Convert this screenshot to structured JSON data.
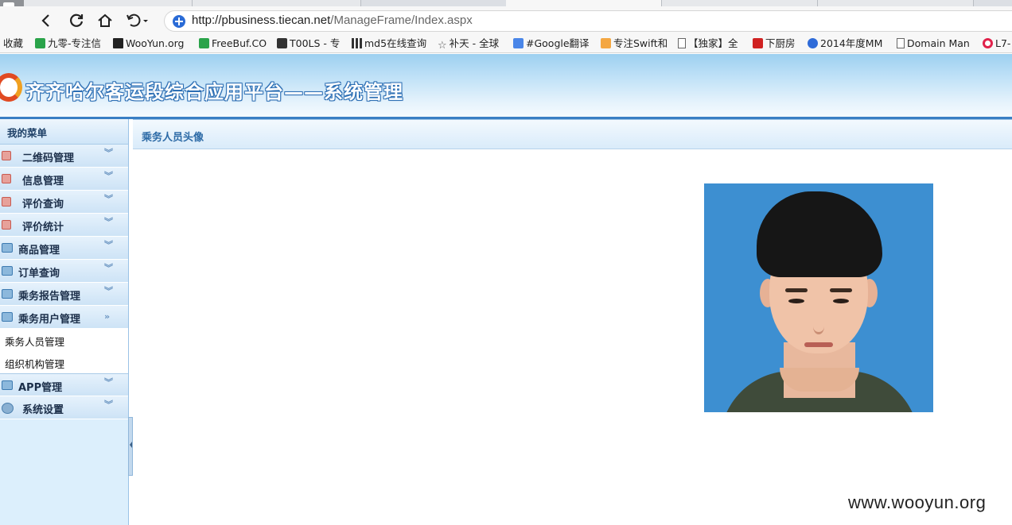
{
  "browser": {
    "url_host": "http://pbusiness.tiecan.net",
    "url_path": "/ManageFrame/Index.aspx",
    "bookmarks": [
      {
        "label": "收藏",
        "icon": "none"
      },
      {
        "label": "九零-专注信",
        "icon": "leaf-icon"
      },
      {
        "label": "WooYun.org",
        "icon": "wooyun-icon"
      },
      {
        "label": "FreeBuf.CO",
        "icon": "freebuf-icon"
      },
      {
        "label": "T00LS - 专",
        "icon": "tools-icon"
      },
      {
        "label": "md5在线查询",
        "icon": "grid-icon"
      },
      {
        "label": "补天 - 全球",
        "icon": "star-icon"
      },
      {
        "label": "#Google翻译",
        "icon": "translate-icon"
      },
      {
        "label": "专注Swift和",
        "icon": "swift-icon"
      },
      {
        "label": "【独家】全",
        "icon": "document-icon"
      },
      {
        "label": "下厨房",
        "icon": "kitchen-icon"
      },
      {
        "label": "2014年度MM",
        "icon": "play-icon"
      },
      {
        "label": "Domain Man",
        "icon": "document-icon"
      },
      {
        "label": "L7-",
        "icon": "ring-icon"
      }
    ]
  },
  "app": {
    "title": "齐齐哈尔客运段综合应用平台——系统管理"
  },
  "sidebar": {
    "title": "我的菜单",
    "items": [
      {
        "label": "二维码管理",
        "icon": "red-icon"
      },
      {
        "label": "信息管理",
        "icon": "red-icon"
      },
      {
        "label": "评价查询",
        "icon": "red-icon"
      },
      {
        "label": "评价统计",
        "icon": "red-icon"
      },
      {
        "label": "商品管理",
        "icon": "stack-icon"
      },
      {
        "label": "订单查询",
        "icon": "stack-icon"
      },
      {
        "label": "乘务报告管理",
        "icon": "stack-icon"
      },
      {
        "label": "乘务用户管理",
        "icon": "stack-icon",
        "expanded": true,
        "children": [
          "乘务人员管理",
          "组织机构管理"
        ]
      },
      {
        "label": "APP管理",
        "icon": "stack-icon"
      },
      {
        "label": "系统设置",
        "icon": "gear-icon"
      }
    ]
  },
  "main": {
    "panel_title": "乘务人员头像"
  },
  "watermark": "www.wooyun.org"
}
